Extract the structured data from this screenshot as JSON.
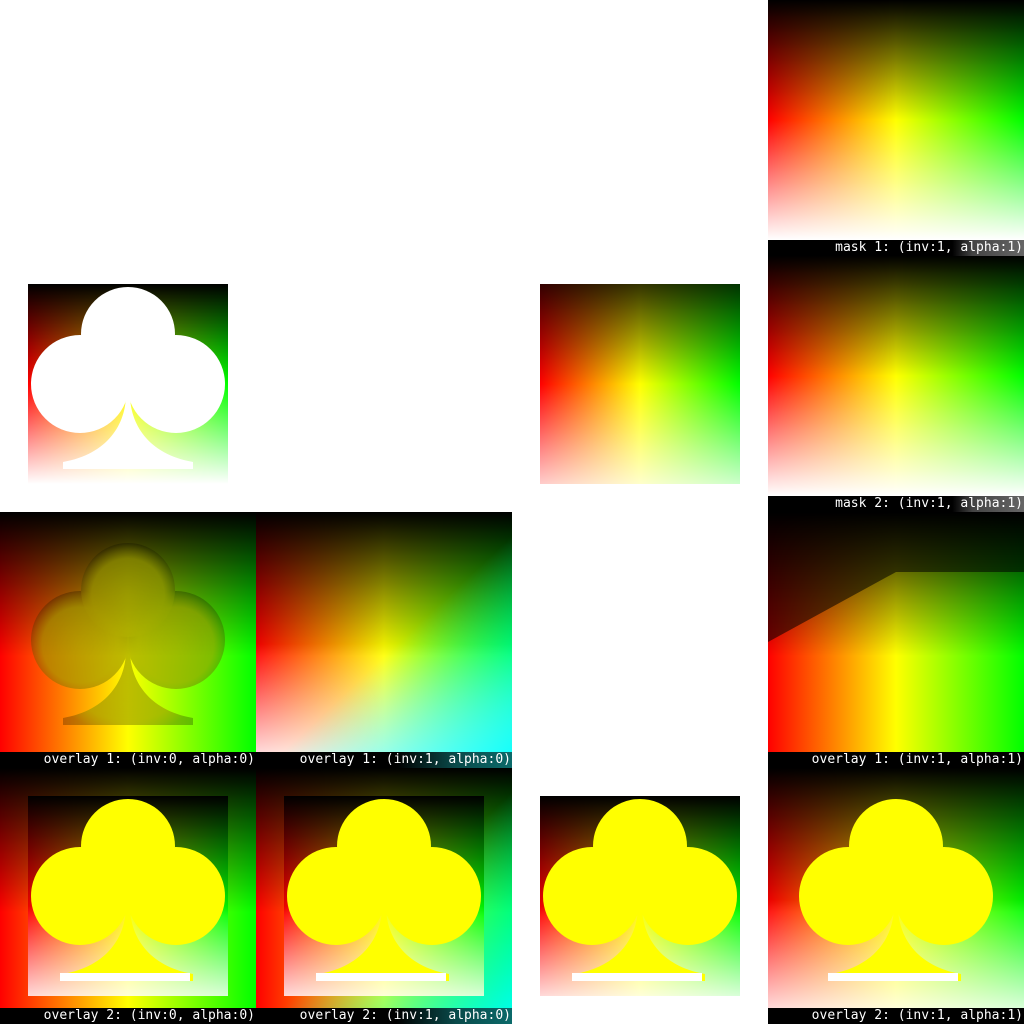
{
  "icons": {
    "shape": "club-icon"
  },
  "colors": {
    "red": "#ff0000",
    "yellow": "#ffff00",
    "green": "#00ff00",
    "black": "#000000",
    "white": "#ffffff",
    "cyan": "#00ffff"
  },
  "labels": {
    "mask1": "mask 1: (inv:1, alpha:1)",
    "mask2": "mask 2: (inv:1, alpha:1)",
    "overlay1_inv0": "overlay 1: (inv:0, alpha:0)",
    "overlay1_inv1_alpha0": "overlay 1: (inv:1, alpha:0)",
    "overlay1_inv1_alpha1": "overlay 1: (inv:1, alpha:1)",
    "overlay2_inv0": "overlay 2: (inv:0, alpha:0)",
    "overlay2_inv1_alpha0": "overlay 2: (inv:1, alpha:0)",
    "overlay2_inv1_alpha1": "overlay 2: (inv:1, alpha:1)"
  }
}
